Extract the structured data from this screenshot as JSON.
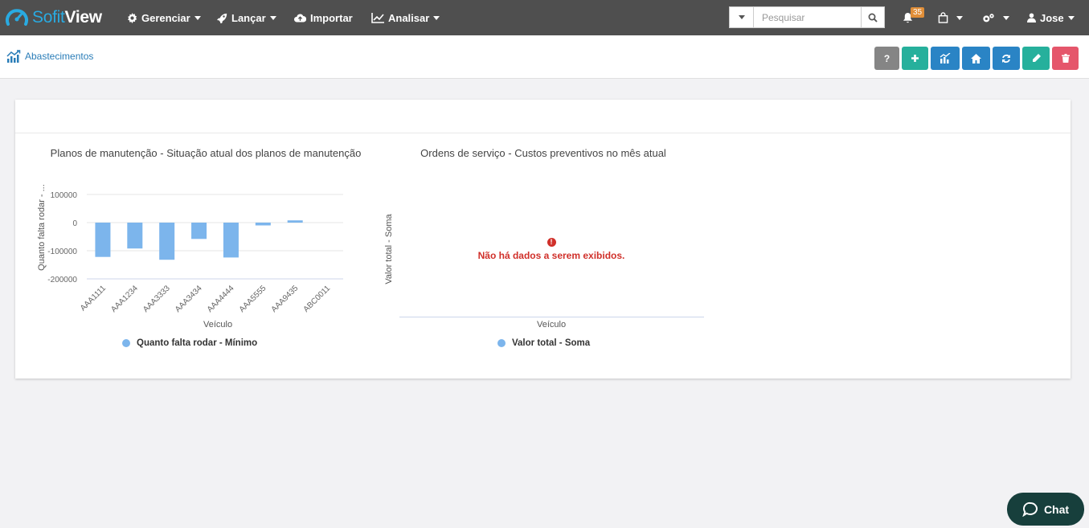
{
  "brand": {
    "part1": "Sofit",
    "part2": "View"
  },
  "nav": {
    "gerenciar": "Gerenciar",
    "lancar": "Lançar",
    "importar": "Importar",
    "analisar": "Analisar"
  },
  "search": {
    "placeholder": "Pesquisar"
  },
  "notifications": {
    "count": "35"
  },
  "user": {
    "name": "Jose"
  },
  "breadcrumb": {
    "label": "Abastecimentos"
  },
  "toolbar": {
    "help_label": "?",
    "colors": {
      "help": "#858585",
      "add": "#26b09c",
      "blue": "#2a84c5",
      "edit": "#26b09c",
      "delete": "#e5566b"
    }
  },
  "chart1": {
    "title": "Planos de manutenção - Situação atual dos planos de manutenção",
    "ylabel": "Quanto falta rodar - ...",
    "xlabel": "Veículo",
    "legend": "Quanto falta rodar - Mínimo",
    "yticks": [
      "100000",
      "0",
      "-100000",
      "-200000"
    ]
  },
  "chart2": {
    "title": "Ordens de serviço - Custos preventivos no mês atual",
    "ylabel": "Valor total - Soma",
    "xlabel": "Veículo",
    "legend": "Valor total - Soma",
    "nodata_icon": "!",
    "nodata": "Não há dados a serem exibidos."
  },
  "chat": {
    "label": "Chat"
  },
  "chart_data": [
    {
      "type": "bar",
      "title": "Planos de manutenção - Situação atual dos planos de manutenção",
      "xlabel": "Veículo",
      "ylabel": "Quanto falta rodar - ...",
      "categories": [
        "AAA1111",
        "AAA1234",
        "AAA3333",
        "AAA3434",
        "AAA4444",
        "AAA5555",
        "AAA9435",
        "ABC0011"
      ],
      "series": [
        {
          "name": "Quanto falta rodar - Mínimo",
          "values": [
            -122000,
            -92000,
            -132000,
            -58000,
            -124000,
            -10000,
            8000,
            0
          ]
        }
      ],
      "ylim": [
        -200000,
        100000
      ],
      "grid": true,
      "legend": "bottom",
      "color": "#7cb5ec"
    },
    {
      "type": "bar",
      "title": "Ordens de serviço - Custos preventivos no mês atual",
      "xlabel": "Veículo",
      "ylabel": "Valor total - Soma",
      "categories": [],
      "series": [
        {
          "name": "Valor total - Soma",
          "values": []
        }
      ],
      "legend": "bottom",
      "color": "#7cb5ec"
    }
  ]
}
